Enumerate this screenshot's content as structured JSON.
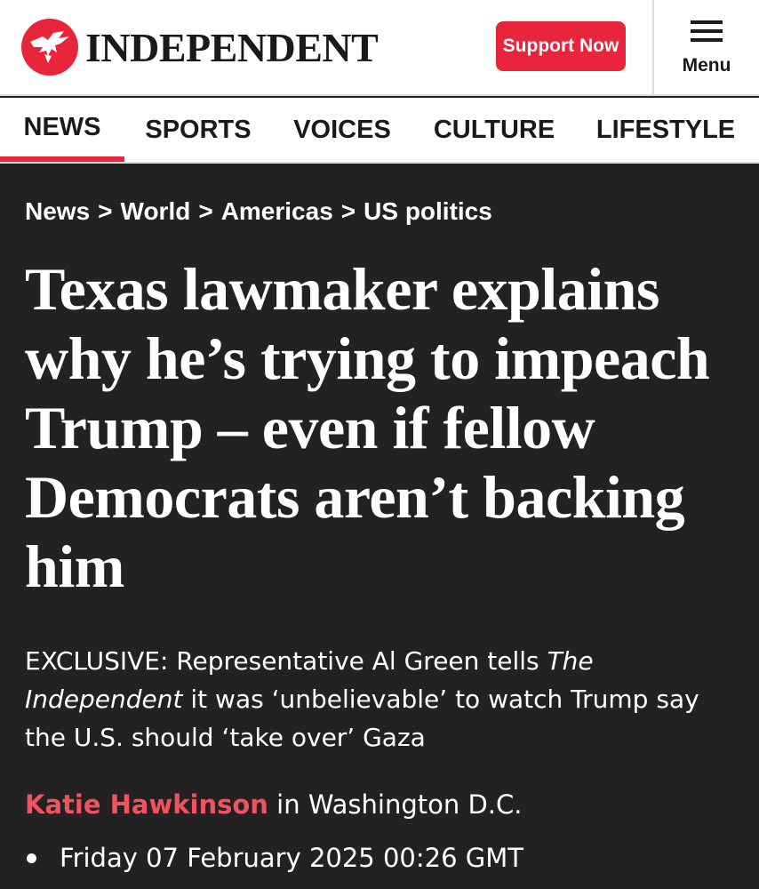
{
  "header": {
    "brand": "INDEPENDENT",
    "support_label": "Support Now",
    "menu_label": "Menu",
    "logo_icon": "eagle-icon",
    "menu_icon": "hamburger-icon"
  },
  "nav": {
    "items": [
      {
        "label": "NEWS",
        "active": true
      },
      {
        "label": "SPORTS",
        "active": false
      },
      {
        "label": "VOICES",
        "active": false
      },
      {
        "label": "CULTURE",
        "active": false
      },
      {
        "label": "LIFESTYLE",
        "active": false
      }
    ]
  },
  "article": {
    "breadcrumb": [
      "News",
      "World",
      "Americas",
      "US politics"
    ],
    "breadcrumb_separator": ">",
    "headline": "Texas lawmaker explains why he’s trying to impeach Trump – even if fellow Democrats aren’t backing him",
    "standfirst": {
      "prefix": "EXCLUSIVE: Representative Al Green tells ",
      "publication": "The Independent",
      "suffix": " it was ‘unbelievable’ to watch Trump say the U.S. should ‘take over’ Gaza"
    },
    "author": "Katie Hawkinson",
    "location": " in Washington D.C.",
    "date": "Friday 07 February 2025 00:26 GMT"
  },
  "colors": {
    "brand_red": "#e8253a",
    "author_red": "#f0525f",
    "background": "#222222"
  }
}
